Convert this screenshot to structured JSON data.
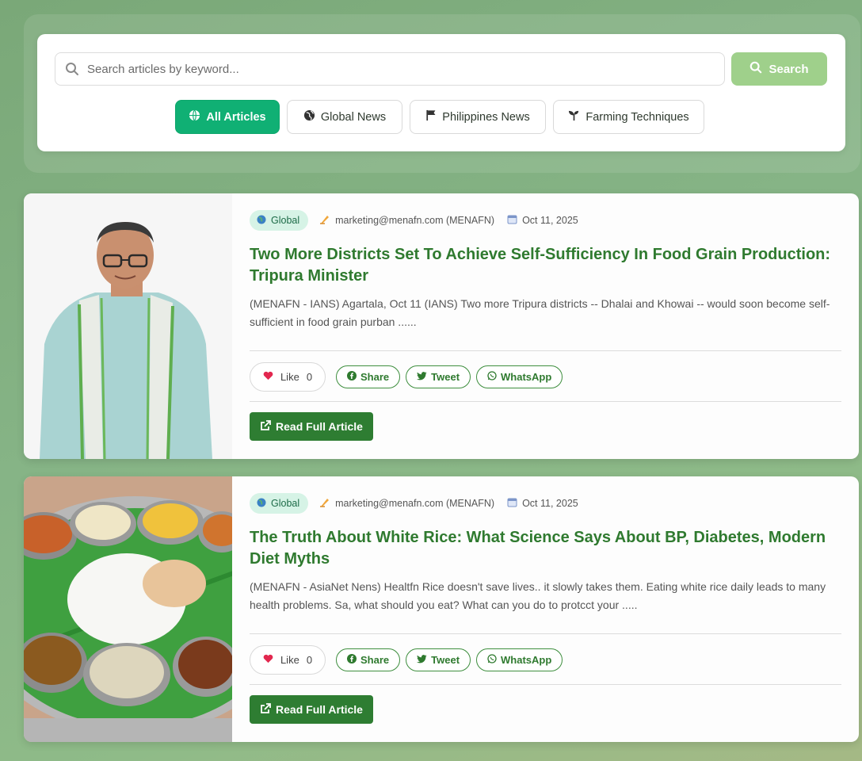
{
  "search": {
    "placeholder": "Search articles by keyword...",
    "button_label": "Search"
  },
  "filters": [
    {
      "label": "All Articles",
      "icon": "globe-icon",
      "active": true
    },
    {
      "label": "Global News",
      "icon": "globe-icon",
      "active": false
    },
    {
      "label": "Philippines News",
      "icon": "flag-icon",
      "active": false
    },
    {
      "label": "Farming Techniques",
      "icon": "seedling-icon",
      "active": false
    }
  ],
  "articles": [
    {
      "badge": "Global",
      "author": "marketing@menafn.com (MENAFN)",
      "date": "Oct 11, 2025",
      "title": "Two More Districts Set To Achieve Self-Sufficiency In Food Grain Production: Tripura Minister",
      "excerpt": "(MENAFN - IANS) Agartala, Oct 11 (IANS) Two more Tripura districts -- Dhalai and Khowai -- would soon become self-sufficient in food grain purban ......",
      "like_label": "Like",
      "like_count": "0",
      "share_label": "Share",
      "tweet_label": "Tweet",
      "whatsapp_label": "WhatsApp",
      "read_label": "Read Full Article",
      "image": "portrait-of-minister"
    },
    {
      "badge": "Global",
      "author": "marketing@menafn.com (MENAFN)",
      "date": "Oct 11, 2025",
      "title": "The Truth About White Rice: What Science Says About BP, Diabetes, Modern Diet Myths",
      "excerpt": "(MENAFN - AsiaNet Nens) Healtfn Rice doesn't save lives.. it slowly takes them. Eating white rice daily leads to many health problems. Sa, what should you eat? What can you do to protcct your .....",
      "like_label": "Like",
      "like_count": "0",
      "share_label": "Share",
      "tweet_label": "Tweet",
      "whatsapp_label": "WhatsApp",
      "read_label": "Read Full Article",
      "image": "rice-thali-plate"
    }
  ],
  "colors": {
    "accent": "#10b074",
    "title_green": "#2f7a2f",
    "search_button": "#9fd08b",
    "read_button": "#2e7d32"
  }
}
